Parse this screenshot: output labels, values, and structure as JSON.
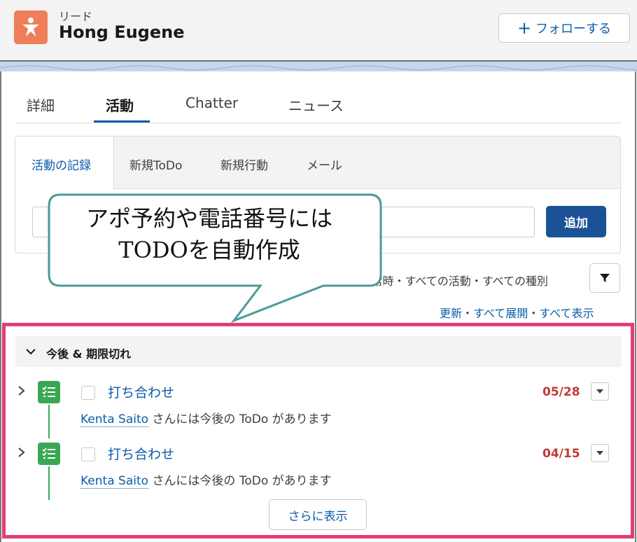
{
  "header": {
    "object_label": "リード",
    "record_name": "Hong Eugene",
    "follow_label": "フォローする"
  },
  "tabs": [
    {
      "label": "詳細",
      "active": false
    },
    {
      "label": "活動",
      "active": true
    },
    {
      "label": "Chatter",
      "active": false
    },
    {
      "label": "ニュース",
      "active": false
    }
  ],
  "composer": {
    "subtabs": [
      {
        "label": "活動の記録",
        "active": true
      },
      {
        "label": "新規ToDo",
        "active": false
      },
      {
        "label": "新規行動",
        "active": false
      },
      {
        "label": "メール",
        "active": false
      }
    ],
    "add_label": "追加"
  },
  "filter": {
    "text": "条件: 常時・すべての活動・すべての種別"
  },
  "links": {
    "refresh": "更新",
    "expand_all": "すべて展開",
    "show_all": "すべて表示",
    "separator": "・"
  },
  "callout": {
    "line1": "アポ予約や電話番号には",
    "line2": "TODOを自動作成"
  },
  "timeline": {
    "section_label": "今後 & 期限切れ",
    "items": [
      {
        "title": "打ち合わせ",
        "date": "05/28",
        "person": "Kenta Saito",
        "desc": "さんには今後の ToDo があります"
      },
      {
        "title": "打ち合わせ",
        "date": "04/15",
        "person": "Kenta Saito",
        "desc": "さんには今後の ToDo があります"
      }
    ],
    "more_label": "さらに表示"
  },
  "colors": {
    "accent_blue": "#0b5cab",
    "lead_orange": "#ee7e5a",
    "task_green": "#3ba755",
    "overdue_red": "#c23934",
    "highlight_pink": "#e43d7a",
    "callout_border": "#4a9a98"
  },
  "icons": {
    "lead": "lead-person-icon",
    "task": "task-list-icon",
    "filter": "filter-funnel-icon",
    "follow": "plus-icon"
  }
}
